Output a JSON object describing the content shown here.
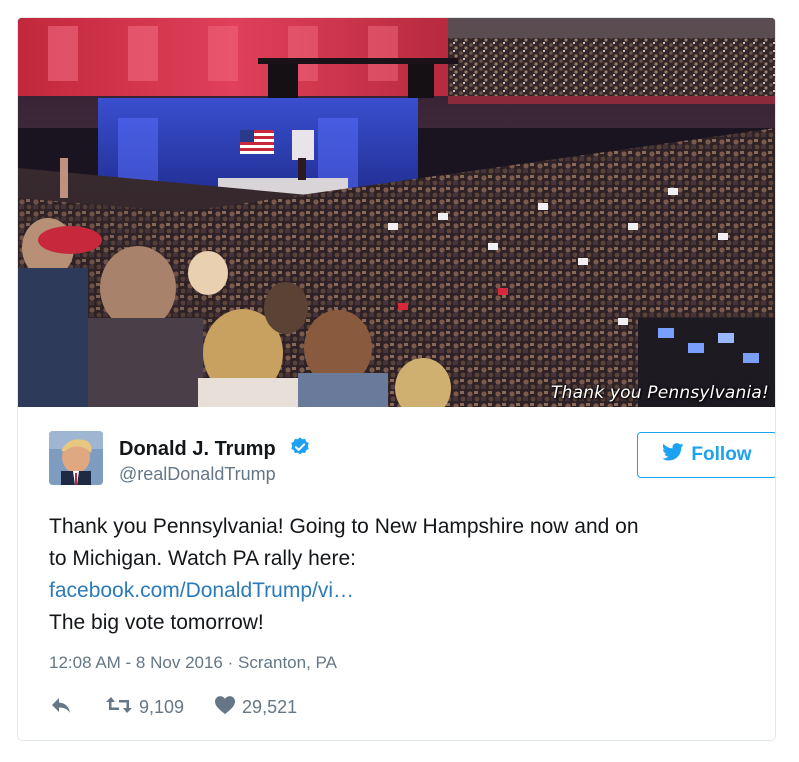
{
  "media": {
    "caption": "Thank you Pennsylvania!"
  },
  "author": {
    "name": "Donald J. Trump",
    "handle": "@realDonaldTrump",
    "verified": true
  },
  "follow_button": {
    "label": "Follow"
  },
  "tweet": {
    "line1": "Thank you Pennsylvania! Going to New Hampshire now and on",
    "line2": "to Michigan. Watch PA rally here:",
    "link": "facebook.com/DonaldTrump/vi…",
    "line4": "The big vote tomorrow!"
  },
  "meta": {
    "timestamp": "12:08 AM - 8 Nov 2016",
    "separator": "·",
    "location": "Scranton, PA"
  },
  "actions": {
    "retweets": "9,109",
    "likes": "29,521"
  },
  "icons": {
    "reply": "reply-icon",
    "retweet": "retweet-icon",
    "like": "heart-icon",
    "verified": "verified-badge-icon",
    "bird": "twitter-bird-icon"
  },
  "colors": {
    "accent": "#1da1f2",
    "link": "#2b7bb9",
    "secondary_text": "#657786",
    "border": "#e1e8ed"
  }
}
